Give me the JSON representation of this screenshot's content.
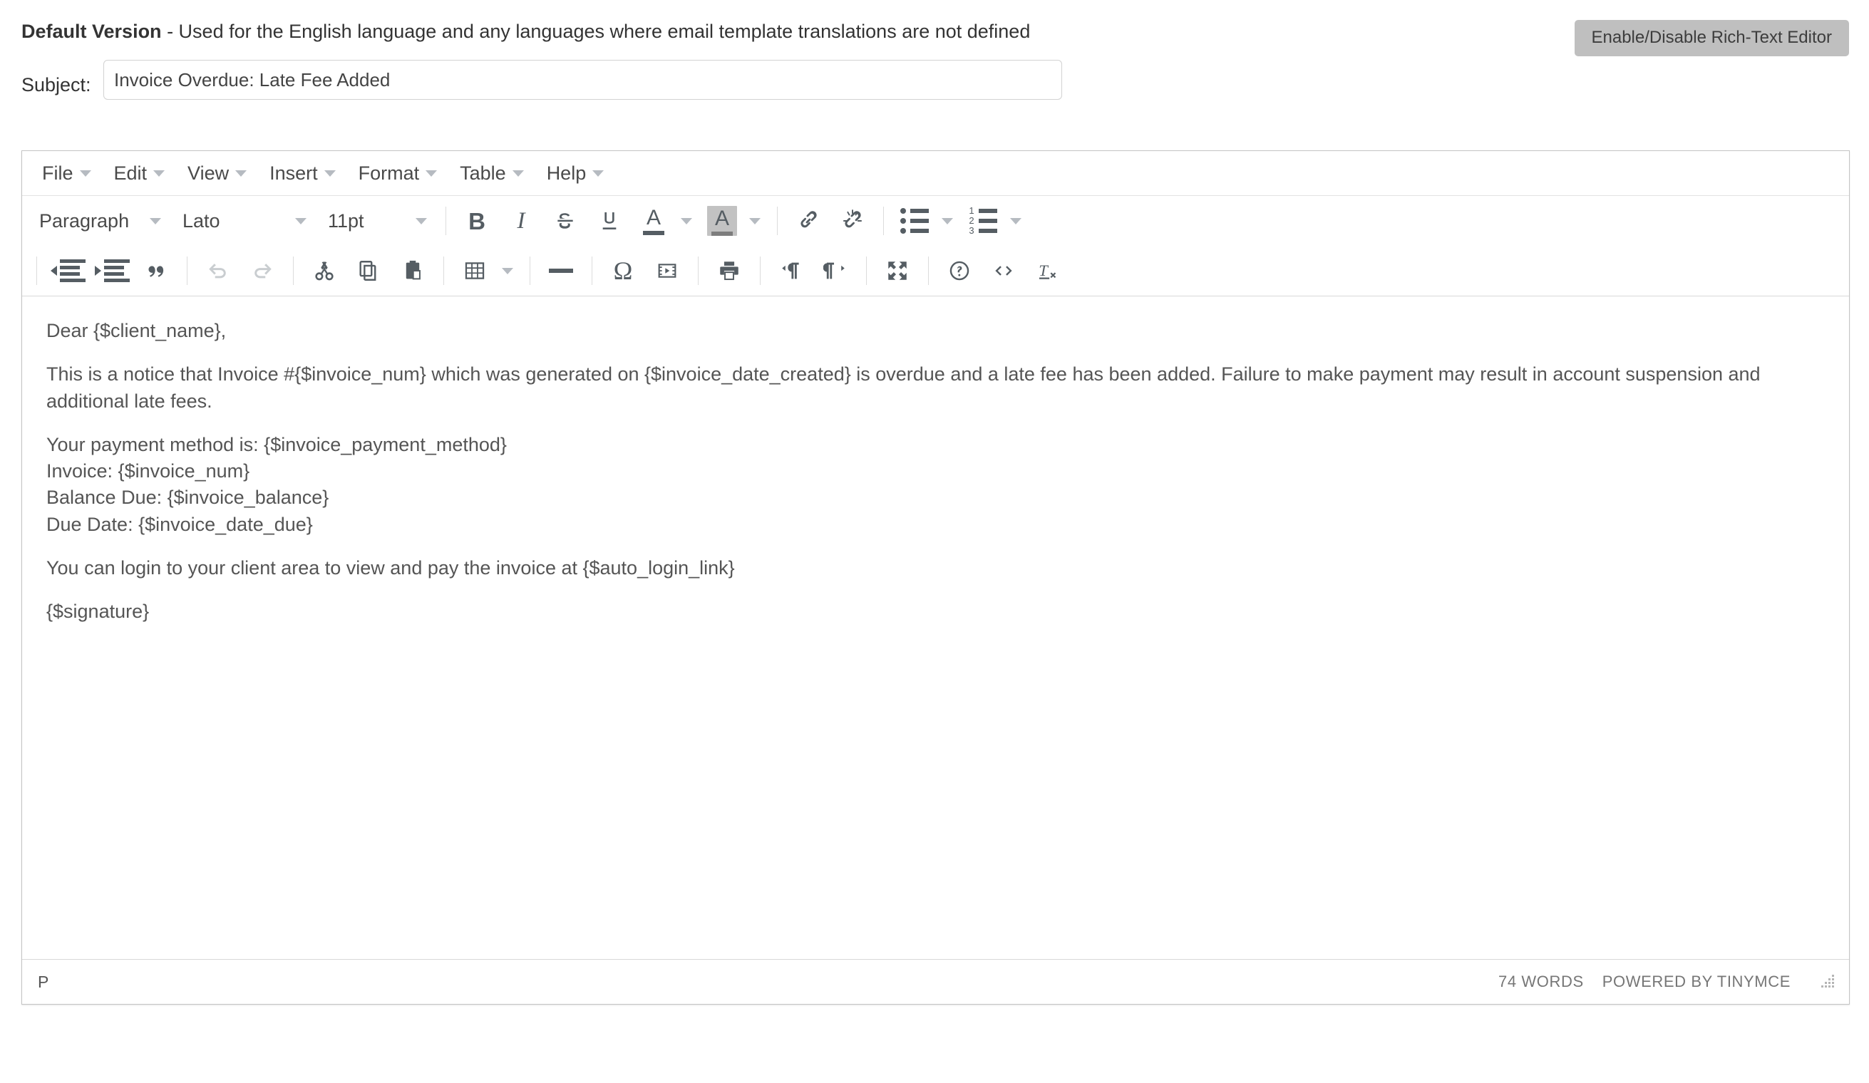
{
  "header": {
    "version_bold": "Default Version",
    "version_rest": " - Used for the English language and any languages where email template translations are not defined",
    "rte_toggle_label": "Enable/Disable Rich-Text Editor",
    "rte_toggle_bg": "#bfbfbf"
  },
  "subject": {
    "label": "Subject:",
    "value": "Invoice Overdue: Late Fee Added",
    "placeholder": ""
  },
  "editor": {
    "menubar": [
      {
        "label": "File",
        "name": "menu-file"
      },
      {
        "label": "Edit",
        "name": "menu-edit"
      },
      {
        "label": "View",
        "name": "menu-view"
      },
      {
        "label": "Insert",
        "name": "menu-insert"
      },
      {
        "label": "Format",
        "name": "menu-format"
      },
      {
        "label": "Table",
        "name": "menu-table"
      },
      {
        "label": "Help",
        "name": "menu-help"
      }
    ],
    "toolbar_row1": {
      "block_format": "Paragraph",
      "font_family": "Lato",
      "font_size": "11pt",
      "buttons": [
        "bold",
        "italic",
        "strikethrough",
        "underline",
        "forecolor",
        "backcolor",
        "link",
        "unlink",
        "bullist",
        "numlist"
      ]
    },
    "toolbar_row2": {
      "buttons": [
        "outdent",
        "indent",
        "blockquote",
        "undo",
        "redo",
        "cut",
        "copy",
        "paste",
        "table",
        "hr",
        "charmap",
        "media",
        "print",
        "ltr",
        "rtl",
        "fullscreen",
        "help",
        "code",
        "removeformat"
      ],
      "undo_disabled": true,
      "redo_disabled": true
    },
    "content": {
      "greeting": "Dear {$client_name},",
      "notice": "This is a notice that Invoice #{$invoice_num} which was generated on {$invoice_date_created} is overdue and a late fee has been added. Failure to make payment may result in account suspension and additional late fees.",
      "details": "Your payment method is: {$invoice_payment_method}\nInvoice: {$invoice_num}\nBalance Due: {$invoice_balance}\nDue Date: {$invoice_date_due}",
      "login_line": "You can login to your client area to view and pay the invoice at {$auto_login_link}",
      "signature": "{$signature}"
    },
    "statusbar": {
      "element_path": "P",
      "word_count": "74 WORDS",
      "brand": "POWERED BY TINYMCE"
    }
  }
}
